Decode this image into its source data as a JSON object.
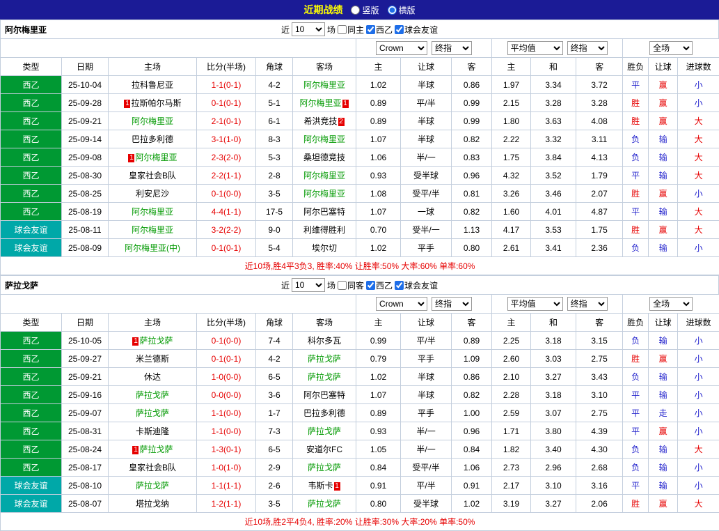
{
  "topbar": {
    "title": "近期战绩",
    "layout_options": [
      {
        "label": "竖版",
        "selected": false
      },
      {
        "label": "横版",
        "selected": true
      }
    ]
  },
  "columns": [
    "类型",
    "日期",
    "主场",
    "比分(半场)",
    "角球",
    "客场",
    "主",
    "让球",
    "客",
    "主",
    "和",
    "客",
    "胜负",
    "让球",
    "进球数"
  ],
  "colors": {
    "league_green": "#009933",
    "friendly_teal": "#00a8a8",
    "focus_team": "#009900",
    "win_red": "#e60000",
    "loss_blue": "#2222cc",
    "topbar_bg": "#1b1b96",
    "title_yellow": "#ffff00"
  },
  "sections": [
    {
      "team": "阿尔梅里亚",
      "filter": {
        "near_label": "近",
        "count": "10",
        "matches_label": "场",
        "checkboxes": [
          {
            "label": "同主",
            "checked": false
          },
          {
            "label": "西乙",
            "checked": true
          },
          {
            "label": "球会友谊",
            "checked": true
          }
        ]
      },
      "odds_selects": {
        "company": "Crown",
        "company_mode": "终指",
        "average": "平均值",
        "average_mode": "终指",
        "scope": "全场"
      },
      "rows": [
        {
          "type": "西乙",
          "type_color": "green",
          "date": "25-10-04",
          "home": {
            "name": "拉科鲁尼亚",
            "focus": false
          },
          "score": "1-1",
          "half": "(0-1)",
          "corner": "4-2",
          "away": {
            "name": "阿尔梅里亚",
            "focus": true
          },
          "asia": [
            "1.02",
            "半球",
            "0.86"
          ],
          "euro": [
            "1.97",
            "3.34",
            "3.72"
          ],
          "outcome": {
            "text": "平",
            "color": "blue"
          },
          "handicap": {
            "text": "赢",
            "color": "red"
          },
          "goals": {
            "text": "小",
            "color": "blue"
          }
        },
        {
          "type": "西乙",
          "type_color": "green",
          "date": "25-09-28",
          "home": {
            "name": "拉斯帕尔马斯",
            "focus": false,
            "card": {
              "num": "1",
              "pos": "left"
            }
          },
          "score": "0-1",
          "half": "(0-1)",
          "corner": "5-1",
          "away": {
            "name": "阿尔梅里亚",
            "focus": true,
            "card": {
              "num": "1",
              "pos": "right"
            }
          },
          "asia": [
            "0.89",
            "平/半",
            "0.99"
          ],
          "euro": [
            "2.15",
            "3.28",
            "3.28"
          ],
          "outcome": {
            "text": "胜",
            "color": "red"
          },
          "handicap": {
            "text": "赢",
            "color": "red"
          },
          "goals": {
            "text": "小",
            "color": "blue"
          }
        },
        {
          "type": "西乙",
          "type_color": "green",
          "date": "25-09-21",
          "home": {
            "name": "阿尔梅里亚",
            "focus": true
          },
          "score": "2-1",
          "half": "(0-1)",
          "corner": "6-1",
          "away": {
            "name": "希洪竞技",
            "focus": false,
            "card": {
              "num": "2",
              "pos": "right"
            }
          },
          "asia": [
            "0.89",
            "半球",
            "0.99"
          ],
          "euro": [
            "1.80",
            "3.63",
            "4.08"
          ],
          "outcome": {
            "text": "胜",
            "color": "red"
          },
          "handicap": {
            "text": "赢",
            "color": "red"
          },
          "goals": {
            "text": "大",
            "color": "red"
          }
        },
        {
          "type": "西乙",
          "type_color": "green",
          "date": "25-09-14",
          "home": {
            "name": "巴拉多利德",
            "focus": false
          },
          "score": "3-1",
          "half": "(1-0)",
          "corner": "8-3",
          "away": {
            "name": "阿尔梅里亚",
            "focus": true
          },
          "asia": [
            "1.07",
            "半球",
            "0.82"
          ],
          "euro": [
            "2.22",
            "3.32",
            "3.11"
          ],
          "outcome": {
            "text": "负",
            "color": "blue"
          },
          "handicap": {
            "text": "输",
            "color": "blue"
          },
          "goals": {
            "text": "大",
            "color": "red"
          }
        },
        {
          "type": "西乙",
          "type_color": "green",
          "date": "25-09-08",
          "home": {
            "name": "阿尔梅里亚",
            "focus": true,
            "card": {
              "num": "1",
              "pos": "left"
            }
          },
          "score": "2-3",
          "half": "(2-0)",
          "corner": "5-3",
          "away": {
            "name": "桑坦德竞技",
            "focus": false
          },
          "asia": [
            "1.06",
            "半/一",
            "0.83"
          ],
          "euro": [
            "1.75",
            "3.84",
            "4.13"
          ],
          "outcome": {
            "text": "负",
            "color": "blue"
          },
          "handicap": {
            "text": "输",
            "color": "blue"
          },
          "goals": {
            "text": "大",
            "color": "red"
          }
        },
        {
          "type": "西乙",
          "type_color": "green",
          "date": "25-08-30",
          "home": {
            "name": "皇家社会B队",
            "focus": false
          },
          "score": "2-2",
          "half": "(1-1)",
          "corner": "2-8",
          "away": {
            "name": "阿尔梅里亚",
            "focus": true
          },
          "asia": [
            "0.93",
            "受半球",
            "0.96"
          ],
          "euro": [
            "4.32",
            "3.52",
            "1.79"
          ],
          "outcome": {
            "text": "平",
            "color": "blue"
          },
          "handicap": {
            "text": "输",
            "color": "blue"
          },
          "goals": {
            "text": "大",
            "color": "red"
          }
        },
        {
          "type": "西乙",
          "type_color": "green",
          "date": "25-08-25",
          "home": {
            "name": "利安尼沙",
            "focus": false
          },
          "score": "0-1",
          "half": "(0-0)",
          "corner": "3-5",
          "away": {
            "name": "阿尔梅里亚",
            "focus": true
          },
          "asia": [
            "1.08",
            "受平/半",
            "0.81"
          ],
          "euro": [
            "3.26",
            "3.46",
            "2.07"
          ],
          "outcome": {
            "text": "胜",
            "color": "red"
          },
          "handicap": {
            "text": "赢",
            "color": "red"
          },
          "goals": {
            "text": "小",
            "color": "blue"
          }
        },
        {
          "type": "西乙",
          "type_color": "green",
          "date": "25-08-19",
          "home": {
            "name": "阿尔梅里亚",
            "focus": true
          },
          "score": "4-4",
          "half": "(1-1)",
          "corner": "17-5",
          "away": {
            "name": "阿尔巴塞特",
            "focus": false
          },
          "asia": [
            "1.07",
            "一球",
            "0.82"
          ],
          "euro": [
            "1.60",
            "4.01",
            "4.87"
          ],
          "outcome": {
            "text": "平",
            "color": "blue"
          },
          "handicap": {
            "text": "输",
            "color": "blue"
          },
          "goals": {
            "text": "大",
            "color": "red"
          }
        },
        {
          "type": "球会友谊",
          "type_color": "teal",
          "date": "25-08-11",
          "home": {
            "name": "阿尔梅里亚",
            "focus": true
          },
          "score": "3-2",
          "half": "(2-2)",
          "corner": "9-0",
          "away": {
            "name": "利维得胜利",
            "focus": false
          },
          "asia": [
            "0.70",
            "受半/一",
            "1.13"
          ],
          "euro": [
            "4.17",
            "3.53",
            "1.75"
          ],
          "outcome": {
            "text": "胜",
            "color": "red"
          },
          "handicap": {
            "text": "赢",
            "color": "red"
          },
          "goals": {
            "text": "大",
            "color": "red"
          }
        },
        {
          "type": "球会友谊",
          "type_color": "teal",
          "date": "25-08-09",
          "home": {
            "name": "阿尔梅里亚(中)",
            "focus": true
          },
          "score": "0-1",
          "half": "(0-1)",
          "corner": "5-4",
          "away": {
            "name": "埃尔切",
            "focus": false
          },
          "asia": [
            "1.02",
            "平手",
            "0.80"
          ],
          "euro": [
            "2.61",
            "3.41",
            "2.36"
          ],
          "outcome": {
            "text": "负",
            "color": "blue"
          },
          "handicap": {
            "text": "输",
            "color": "blue"
          },
          "goals": {
            "text": "小",
            "color": "blue"
          }
        }
      ],
      "summary": "近10场,胜4平3负3, 胜率:40% 让胜率:50% 大率:60% 单率:60%"
    },
    {
      "team": "萨拉戈萨",
      "filter": {
        "near_label": "近",
        "count": "10",
        "matches_label": "场",
        "checkboxes": [
          {
            "label": "同客",
            "checked": false
          },
          {
            "label": "西乙",
            "checked": true
          },
          {
            "label": "球会友谊",
            "checked": true
          }
        ]
      },
      "odds_selects": {
        "company": "Crown",
        "company_mode": "终指",
        "average": "平均值",
        "average_mode": "终指",
        "scope": "全场"
      },
      "rows": [
        {
          "type": "西乙",
          "type_color": "green",
          "date": "25-10-05",
          "home": {
            "name": "萨拉戈萨",
            "focus": true,
            "card": {
              "num": "1",
              "pos": "left"
            }
          },
          "score": "0-1",
          "half": "(0-0)",
          "corner": "7-4",
          "away": {
            "name": "科尔多瓦",
            "focus": false
          },
          "asia": [
            "0.99",
            "平/半",
            "0.89"
          ],
          "euro": [
            "2.25",
            "3.18",
            "3.15"
          ],
          "outcome": {
            "text": "负",
            "color": "blue"
          },
          "handicap": {
            "text": "输",
            "color": "blue"
          },
          "goals": {
            "text": "小",
            "color": "blue"
          }
        },
        {
          "type": "西乙",
          "type_color": "green",
          "date": "25-09-27",
          "home": {
            "name": "米兰德斯",
            "focus": false
          },
          "score": "0-1",
          "half": "(0-1)",
          "corner": "4-2",
          "away": {
            "name": "萨拉戈萨",
            "focus": true
          },
          "asia": [
            "0.79",
            "平手",
            "1.09"
          ],
          "euro": [
            "2.60",
            "3.03",
            "2.75"
          ],
          "outcome": {
            "text": "胜",
            "color": "red"
          },
          "handicap": {
            "text": "赢",
            "color": "red"
          },
          "goals": {
            "text": "小",
            "color": "blue"
          }
        },
        {
          "type": "西乙",
          "type_color": "green",
          "date": "25-09-21",
          "home": {
            "name": "休达",
            "focus": false
          },
          "score": "1-0",
          "half": "(0-0)",
          "corner": "6-5",
          "away": {
            "name": "萨拉戈萨",
            "focus": true
          },
          "asia": [
            "1.02",
            "半球",
            "0.86"
          ],
          "euro": [
            "2.10",
            "3.27",
            "3.43"
          ],
          "outcome": {
            "text": "负",
            "color": "blue"
          },
          "handicap": {
            "text": "输",
            "color": "blue"
          },
          "goals": {
            "text": "小",
            "color": "blue"
          }
        },
        {
          "type": "西乙",
          "type_color": "green",
          "date": "25-09-16",
          "home": {
            "name": "萨拉戈萨",
            "focus": true
          },
          "score": "0-0",
          "half": "(0-0)",
          "corner": "3-6",
          "away": {
            "name": "阿尔巴塞特",
            "focus": false
          },
          "asia": [
            "1.07",
            "半球",
            "0.82"
          ],
          "euro": [
            "2.28",
            "3.18",
            "3.10"
          ],
          "outcome": {
            "text": "平",
            "color": "blue"
          },
          "handicap": {
            "text": "输",
            "color": "blue"
          },
          "goals": {
            "text": "小",
            "color": "blue"
          }
        },
        {
          "type": "西乙",
          "type_color": "green",
          "date": "25-09-07",
          "home": {
            "name": "萨拉戈萨",
            "focus": true
          },
          "score": "1-1",
          "half": "(0-0)",
          "corner": "1-7",
          "away": {
            "name": "巴拉多利德",
            "focus": false
          },
          "asia": [
            "0.89",
            "平手",
            "1.00"
          ],
          "euro": [
            "2.59",
            "3.07",
            "2.75"
          ],
          "outcome": {
            "text": "平",
            "color": "blue"
          },
          "handicap": {
            "text": "走",
            "color": "blue"
          },
          "goals": {
            "text": "小",
            "color": "blue"
          }
        },
        {
          "type": "西乙",
          "type_color": "green",
          "date": "25-08-31",
          "home": {
            "name": "卡斯迪隆",
            "focus": false
          },
          "score": "1-1",
          "half": "(0-0)",
          "corner": "7-3",
          "away": {
            "name": "萨拉戈萨",
            "focus": true
          },
          "asia": [
            "0.93",
            "半/一",
            "0.96"
          ],
          "euro": [
            "1.71",
            "3.80",
            "4.39"
          ],
          "outcome": {
            "text": "平",
            "color": "blue"
          },
          "handicap": {
            "text": "赢",
            "color": "red"
          },
          "goals": {
            "text": "小",
            "color": "blue"
          }
        },
        {
          "type": "西乙",
          "type_color": "green",
          "date": "25-08-24",
          "home": {
            "name": "萨拉戈萨",
            "focus": true,
            "card": {
              "num": "1",
              "pos": "left"
            }
          },
          "score": "1-3",
          "half": "(0-1)",
          "corner": "6-5",
          "away": {
            "name": "安道尔FC",
            "focus": false
          },
          "asia": [
            "1.05",
            "半/一",
            "0.84"
          ],
          "euro": [
            "1.82",
            "3.40",
            "4.30"
          ],
          "outcome": {
            "text": "负",
            "color": "blue"
          },
          "handicap": {
            "text": "输",
            "color": "blue"
          },
          "goals": {
            "text": "大",
            "color": "red"
          }
        },
        {
          "type": "西乙",
          "type_color": "green",
          "date": "25-08-17",
          "home": {
            "name": "皇家社会B队",
            "focus": false
          },
          "score": "1-0",
          "half": "(1-0)",
          "corner": "2-9",
          "away": {
            "name": "萨拉戈萨",
            "focus": true
          },
          "asia": [
            "0.84",
            "受平/半",
            "1.06"
          ],
          "euro": [
            "2.73",
            "2.96",
            "2.68"
          ],
          "outcome": {
            "text": "负",
            "color": "blue"
          },
          "handicap": {
            "text": "输",
            "color": "blue"
          },
          "goals": {
            "text": "小",
            "color": "blue"
          }
        },
        {
          "type": "球会友谊",
          "type_color": "teal",
          "date": "25-08-10",
          "home": {
            "name": "萨拉戈萨",
            "focus": true
          },
          "score": "1-1",
          "half": "(1-1)",
          "corner": "2-6",
          "away": {
            "name": "韦斯卡",
            "focus": false,
            "card": {
              "num": "1",
              "pos": "right"
            }
          },
          "asia": [
            "0.91",
            "平/半",
            "0.91"
          ],
          "euro": [
            "2.17",
            "3.10",
            "3.16"
          ],
          "outcome": {
            "text": "平",
            "color": "blue"
          },
          "handicap": {
            "text": "输",
            "color": "blue"
          },
          "goals": {
            "text": "小",
            "color": "blue"
          }
        },
        {
          "type": "球会友谊",
          "type_color": "teal",
          "date": "25-08-07",
          "home": {
            "name": "塔拉戈纳",
            "focus": false
          },
          "score": "1-2",
          "half": "(1-1)",
          "corner": "3-5",
          "away": {
            "name": "萨拉戈萨",
            "focus": true
          },
          "asia": [
            "0.80",
            "受半球",
            "1.02"
          ],
          "euro": [
            "3.19",
            "3.27",
            "2.06"
          ],
          "outcome": {
            "text": "胜",
            "color": "red"
          },
          "handicap": {
            "text": "赢",
            "color": "red"
          },
          "goals": {
            "text": "大",
            "color": "red"
          }
        }
      ],
      "summary": "近10场,胜2平4负4, 胜率:20% 让胜率:30% 大率:20% 单率:50%"
    }
  ]
}
